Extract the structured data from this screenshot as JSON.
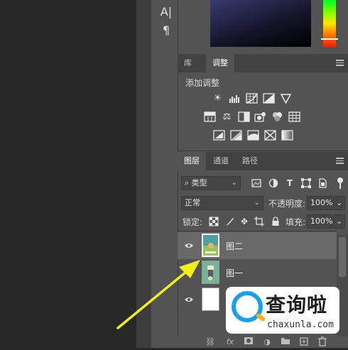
{
  "toolstrip": {
    "char_tool": "A|",
    "para_tool": "¶"
  },
  "colors": {
    "accent_arrow": "#f2ee1e",
    "panel_bg": "#535353",
    "selected_row": "#686868"
  },
  "adjust_panel": {
    "tabs": [
      "库",
      "调整"
    ],
    "title": "添加调整",
    "row1": [
      "brightness-icon",
      "levels-icon",
      "curves-icon",
      "exposure-icon",
      "vibrance-icon"
    ],
    "row2": [
      "hue-saturation-icon",
      "color-balance-icon",
      "black-white-icon",
      "photo-filter-icon",
      "channel-mixer-icon",
      "color-lookup-icon"
    ],
    "row3": [
      "invert-icon",
      "posterize-icon",
      "threshold-icon",
      "selective-color-icon",
      "gradient-map-icon"
    ]
  },
  "layers_panel": {
    "tabs": [
      "图层",
      "通道",
      "路径"
    ],
    "filter_label": "类型",
    "blend_mode": "正常",
    "opacity_label": "不透明度:",
    "opacity_value": "100%",
    "lock_label": "锁定:",
    "fill_label": "填充:",
    "fill_value": "100%",
    "layers": [
      {
        "name": "图二",
        "selected": true
      },
      {
        "name": "图一",
        "selected": false
      },
      {
        "name": "",
        "selected": false
      }
    ],
    "bottom_icons": [
      "link-icon",
      "fx-icon",
      "mask-icon",
      "adjustment-icon",
      "group-icon",
      "new-layer-icon",
      "delete-icon"
    ],
    "bottom_fx": "fx"
  },
  "watermark": {
    "title": "查询啦",
    "subtitle": "chaxunla.com"
  }
}
